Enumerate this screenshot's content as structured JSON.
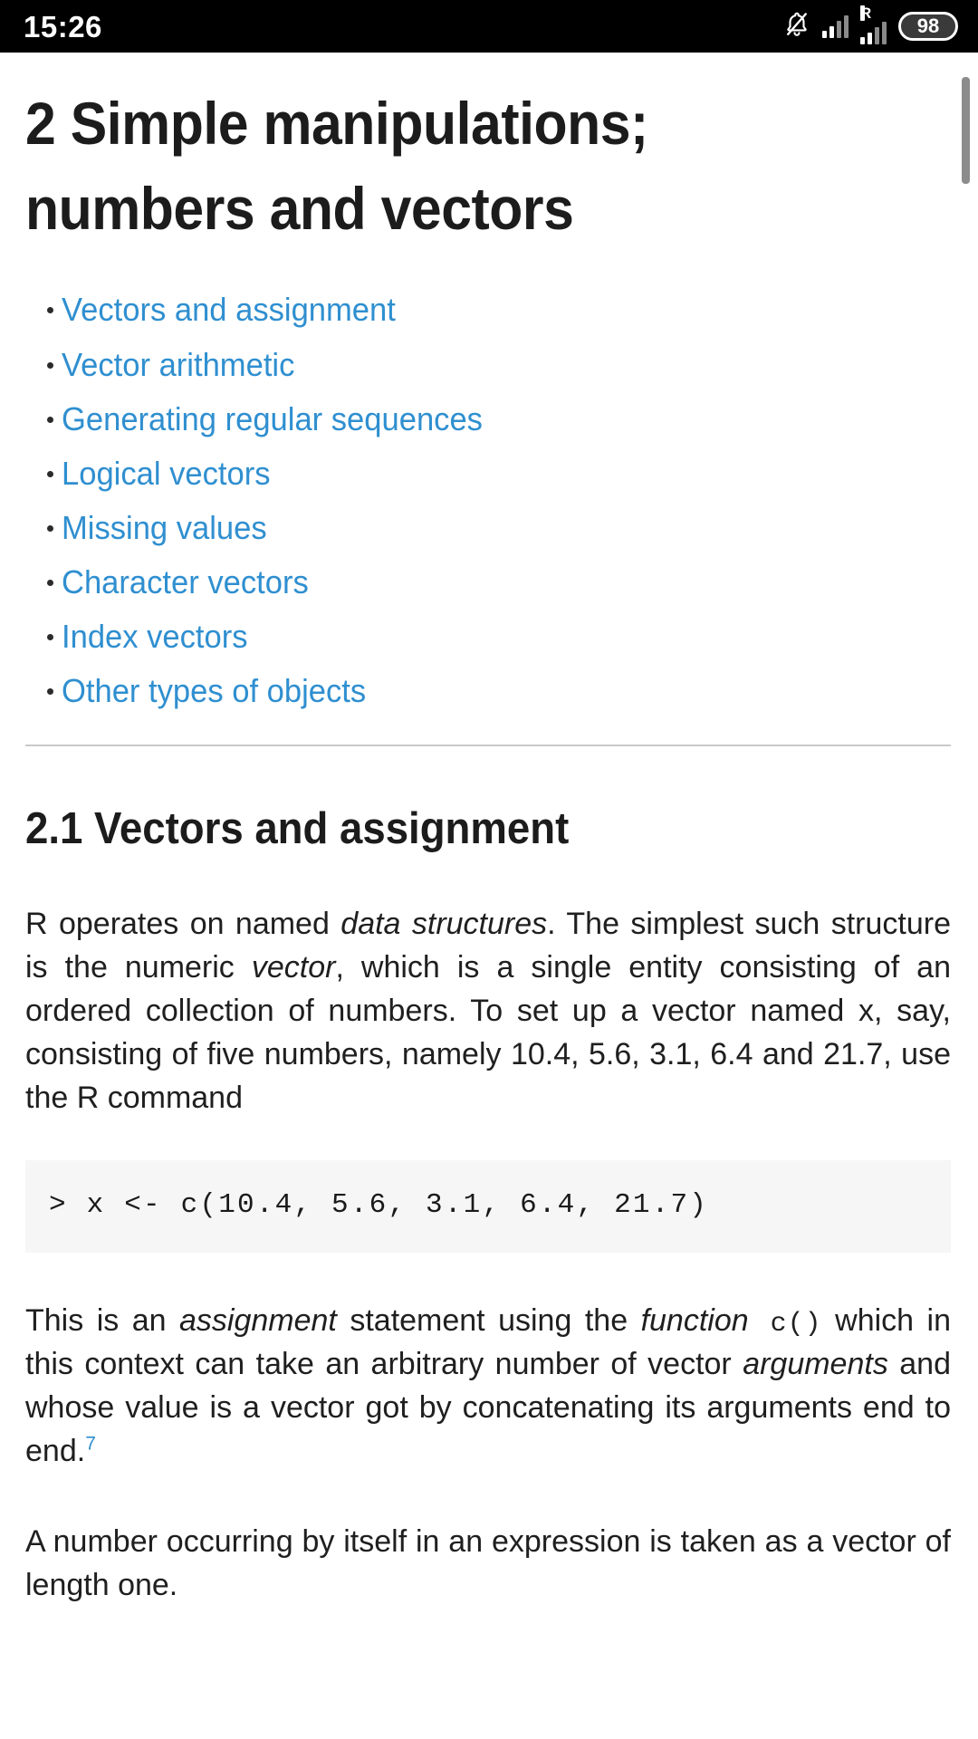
{
  "status_bar": {
    "clock": "15:26",
    "icons": [
      {
        "name": "notifications-muted-icon"
      },
      {
        "name": "signal-bars-icon",
        "bars_filled": 2,
        "bars_total": 4
      },
      {
        "name": "roaming-signal-icon",
        "roaming_label": "R",
        "bars_filled": 2,
        "bars_total": 4
      }
    ],
    "battery": {
      "level": "98"
    }
  },
  "colors": {
    "link": "#2f8fd0",
    "text": "#1f1f1f",
    "heading": "#1c1c1c",
    "code_background": "#f6f6f6",
    "status_background": "#000000",
    "divider": "#c9c9c9",
    "scrollbar": "#8c8c8c"
  },
  "document": {
    "title": "2 Simple manipulations; numbers and vectors",
    "toc": [
      {
        "label": "Vectors and assignment"
      },
      {
        "label": "Vector arithmetic"
      },
      {
        "label": "Generating regular sequences"
      },
      {
        "label": "Logical vectors"
      },
      {
        "label": "Missing values"
      },
      {
        "label": "Character vectors"
      },
      {
        "label": "Index vectors"
      },
      {
        "label": "Other types of objects"
      }
    ],
    "section_title": "2.1 Vectors and assignment",
    "paragraph_1": {
      "part_1": "R operates on named ",
      "em_1": "data structures",
      "part_2": ". The simplest such structure is the numeric ",
      "em_2": "vector",
      "part_3": ", which is a single entity consisting of an ordered collection of numbers. To set up a vector named x, say, consisting of five numbers, namely 10.4, 5.6, 3.1, 6.4 and 21.7, use the R command"
    },
    "code_block": "> x <- c(10.4, 5.6, 3.1, 6.4, 21.7)",
    "paragraph_2": {
      "part_1": "This is an ",
      "em_1": "assignment",
      "part_2": " statement using the ",
      "em_2": "function",
      "code_1": " c()",
      "part_3": " which in this context can take an arbitrary number of vector ",
      "em_3": "arguments",
      "part_4": " and whose value is a vector got by concatenating its arguments end to end.",
      "footnote": "7"
    },
    "paragraph_3": "A number occurring by itself in an expression is taken as a vector of length one."
  }
}
